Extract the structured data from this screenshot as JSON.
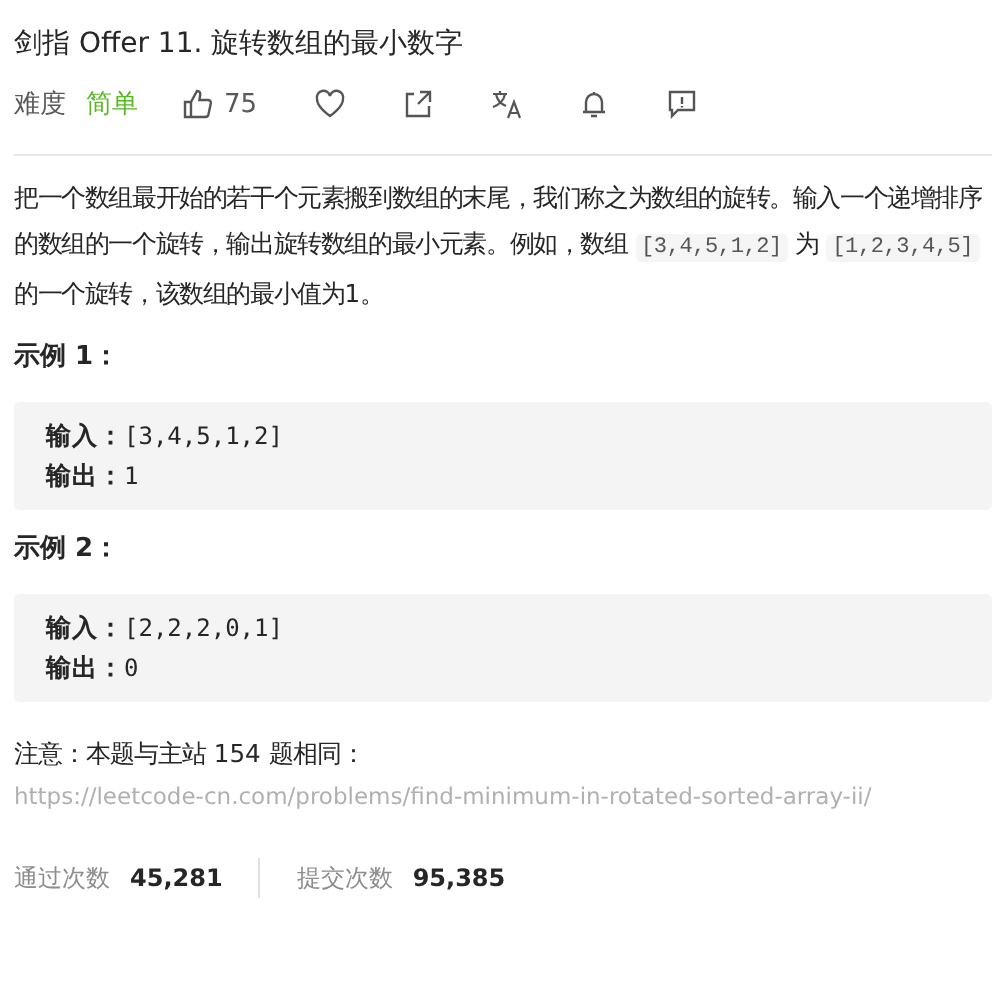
{
  "title": "剑指 Offer 11. 旋转数组的最小数字",
  "meta": {
    "difficulty_label": "难度",
    "difficulty": "简单",
    "likes": "75"
  },
  "description": [
    {
      "kind": "text",
      "text": "把一个数组最开始的若干个元素搬到数组的末尾，我们称之为数组的旋转。输入一个递增排序的数组的一个旋转，输出旋转数组的最小元素。例如，数组 "
    },
    {
      "kind": "code",
      "text": "[3,4,5,1,2]"
    },
    {
      "kind": "text",
      "text": " 为 "
    },
    {
      "kind": "code",
      "text": "[1,2,3,4,5]"
    },
    {
      "kind": "text",
      "text": " 的一个旋转，该数组的最小值为1。"
    }
  ],
  "examples": [
    {
      "heading": "示例 1：",
      "input_label": "输入：",
      "input": "[3,4,5,1,2]",
      "output_label": "输出：",
      "output": "1"
    },
    {
      "heading": "示例 2：",
      "input_label": "输入：",
      "input": "[2,2,2,0,1]",
      "output_label": "输出：",
      "output": "0"
    }
  ],
  "note": {
    "text": "注意：本题与主站 154 题相同：",
    "link": "https://leetcode-cn.com/problems/find-minimum-in-rotated-sorted-array-ii/"
  },
  "stats": [
    {
      "label": "通过次数",
      "value": "45,281"
    },
    {
      "label": "提交次数",
      "value": "95,385"
    }
  ]
}
